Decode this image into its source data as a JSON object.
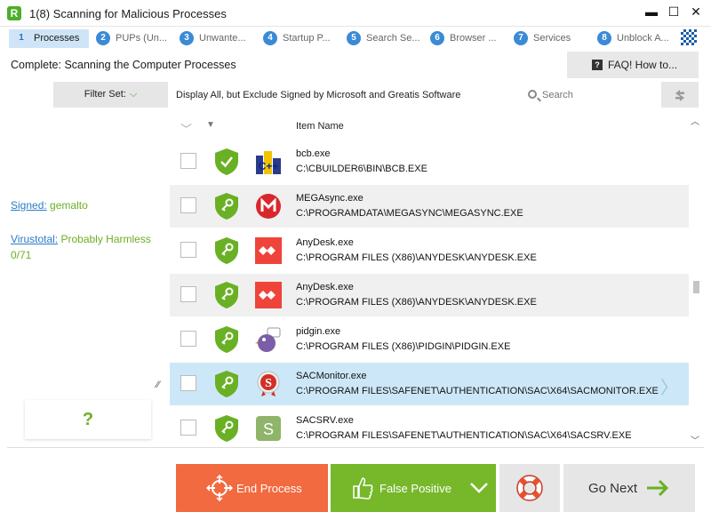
{
  "window": {
    "title": "1(8) Scanning for Malicious Processes",
    "logo_letter": "R",
    "minimize": "▬",
    "maximize": "☐",
    "close": "✕"
  },
  "steps": [
    {
      "num": "1",
      "label": "Processes",
      "active": true
    },
    {
      "num": "2",
      "label": "PUPs (Un...",
      "active": false
    },
    {
      "num": "3",
      "label": "Unwante...",
      "active": false
    },
    {
      "num": "4",
      "label": "Startup P...",
      "active": false
    },
    {
      "num": "5",
      "label": "Search Se...",
      "active": false
    },
    {
      "num": "6",
      "label": "Browser ...",
      "active": false
    },
    {
      "num": "7",
      "label": "Services",
      "active": false
    },
    {
      "num": "8",
      "label": "Unblock A...",
      "active": false
    }
  ],
  "status": "Complete: Scanning the Computer Processes",
  "faq_label": "FAQ! How to...",
  "filter": {
    "label": "Filter Set:",
    "chevron": "⌵",
    "description": "Display All, but Exclude Signed by Microsoft and Greatis Software"
  },
  "search": {
    "placeholder": "Search"
  },
  "info": {
    "signed_label": "Signed:",
    "signed_value": "gemalto",
    "virustotal_label": "Virustotal:",
    "virustotal_value": "Probably Harmless",
    "virustotal_ratio": "0/71"
  },
  "help_label": "?",
  "list": {
    "header": "Item Name",
    "items": [
      {
        "name": "bcb.exe",
        "path": "C:\\CBUILDER6\\BIN\\BCB.EXE",
        "icon": "cbuilder-icon",
        "shield": "check"
      },
      {
        "name": "MEGAsync.exe",
        "path": "C:\\PROGRAMDATA\\MEGASYNC\\MEGASYNC.EXE",
        "icon": "mega-icon",
        "shield": "key"
      },
      {
        "name": "AnyDesk.exe",
        "path": "C:\\PROGRAM FILES (X86)\\ANYDESK\\ANYDESK.EXE",
        "icon": "anydesk-icon",
        "shield": "key"
      },
      {
        "name": "AnyDesk.exe",
        "path": "C:\\PROGRAM FILES (X86)\\ANYDESK\\ANYDESK.EXE",
        "icon": "anydesk-icon",
        "shield": "key"
      },
      {
        "name": "pidgin.exe",
        "path": "C:\\PROGRAM FILES (X86)\\PIDGIN\\PIDGIN.EXE",
        "icon": "pidgin-icon",
        "shield": "key"
      },
      {
        "name": "SACMonitor.exe",
        "path": "C:\\PROGRAM FILES\\SAFENET\\AUTHENTICATION\\SAC\\X64\\SACMONITOR.EXE",
        "icon": "safenet-icon",
        "shield": "key"
      },
      {
        "name": "SACSRV.exe",
        "path": "C:\\PROGRAM FILES\\SAFENET\\AUTHENTICATION\\SAC\\X64\\SACSRV.EXE",
        "icon": "sacsrv-icon",
        "shield": "key"
      }
    ]
  },
  "buttons": {
    "end_process": "End Process",
    "false_positive": "False Positive",
    "go_next": "Go Next"
  },
  "colors": {
    "accent_green": "#76b82a",
    "end_orange": "#f26a3f",
    "link_blue": "#2a7cc7",
    "selected_row": "#cce8f8"
  }
}
